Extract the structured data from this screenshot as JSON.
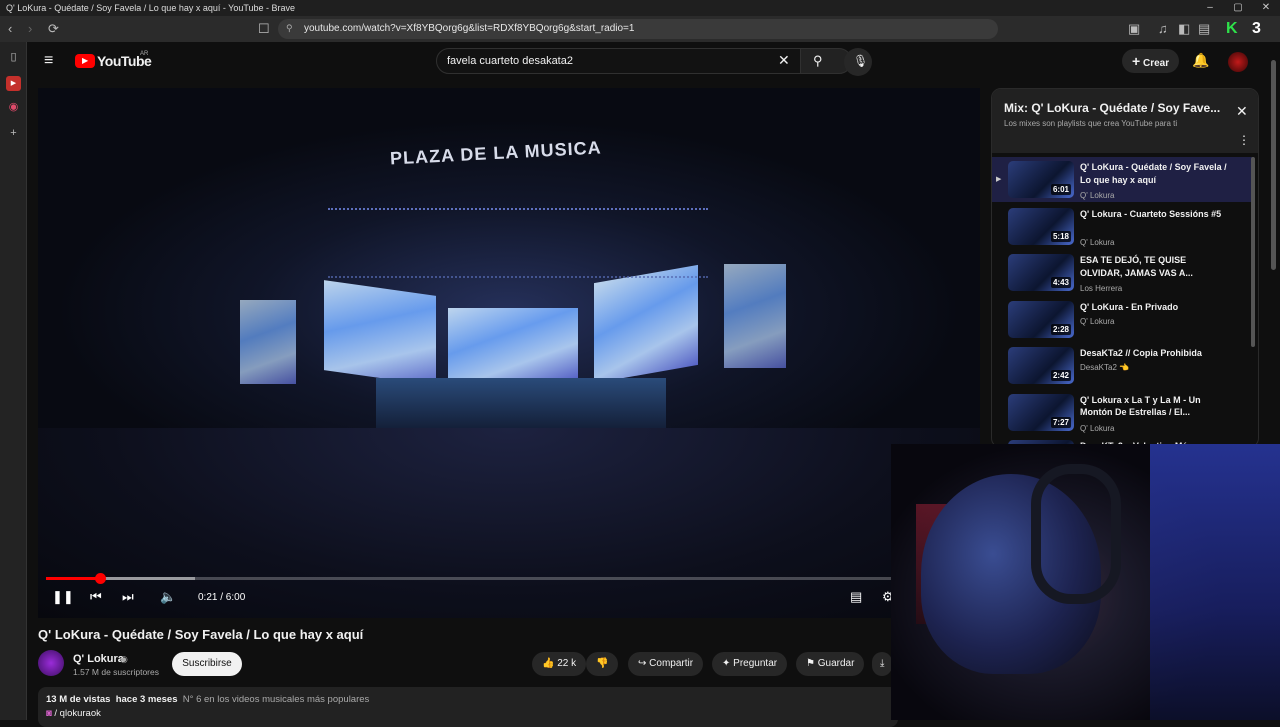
{
  "window": {
    "title": "Q' LoKura - Quédate / Soy Favela / Lo que hay x aquí - YouTube - Brave"
  },
  "browser": {
    "url": "youtube.com/watch?v=Xf8YBQorg6g&list=RDXf8YBQorg6g&start_radio=1"
  },
  "header": {
    "logo": "YouTube",
    "region": "AR",
    "search_value": "favela cuarteto desakata2",
    "create_label": "Crear"
  },
  "player": {
    "venue_text": "PLAZA DE LA MUSICA",
    "time_current": "0:21",
    "time_total": "6:00",
    "time_display": "0:21 / 6:00",
    "progress_fraction": 0.058,
    "buffer_fraction": 0.16
  },
  "video": {
    "title": "Q' LoKura - Quédate / Soy Favela / Lo que hay x aquí",
    "channel": "Q' Lokura",
    "subscribers": "1.57 M de suscriptores",
    "subscribe_label": "Suscribirse",
    "likes": "22 k",
    "share_label": "Compartir",
    "ask_label": "Preguntar",
    "save_label": "Guardar",
    "views": "13 M de vistas",
    "age": "hace 3 meses",
    "ranking": "N° 6 en los videos musicales más populares",
    "hashtag_line": "/ qlokuraok"
  },
  "playlist": {
    "title": "Mix: Q' LoKura - Quédate / Soy Fave...",
    "subtitle": "Los mixes son playlists que crea YouTube para ti",
    "items": [
      {
        "title": "Q' LoKura - Quédate / Soy Favela / Lo que hay x aquí",
        "channel": "Q' Lokura",
        "duration": "6:01",
        "playing": true
      },
      {
        "title": "Q' Lokura - Cuarteto Sessións #5",
        "channel": "Q' Lokura",
        "duration": "5:18"
      },
      {
        "title": "ESA TE DEJÓ, TE QUISE OLVIDAR, JAMAS VAS A...",
        "channel": "Los Herrera",
        "duration": "4:43"
      },
      {
        "title": "Q' LoKura - En Privado",
        "channel": "Q' Lokura",
        "duration": "2:28"
      },
      {
        "title": "DesaKTa2 // Copia Prohibida",
        "channel": "DesaKTa2 👈",
        "duration": "2:42"
      },
      {
        "title": "Q' Lokura x La T y La M - Un Montón De Estrellas / El...",
        "channel": "Q' Lokura",
        "duration": "7:27"
      },
      {
        "title": "DesaKTa2 x Valentina Márquez",
        "channel": "",
        "duration": ""
      }
    ]
  },
  "colors": {
    "accent": "#ff0000",
    "background": "#0f0f0f",
    "panel_header": "#212121"
  }
}
